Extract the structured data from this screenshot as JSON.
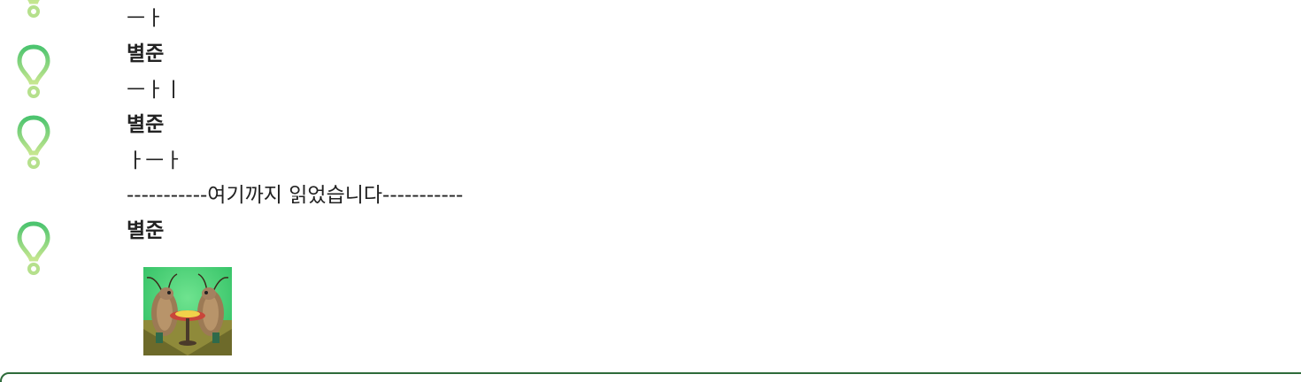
{
  "messages": [
    {
      "type": "text",
      "text": "ㅡㅏ"
    },
    {
      "type": "text",
      "sender": "별준",
      "avatar_icon": "balloon-pin-icon",
      "text": "ㅡㅏㅣ"
    },
    {
      "type": "text",
      "sender": "별준",
      "avatar_icon": "balloon-pin-icon",
      "text": "ㅏㅡㅏ"
    },
    {
      "type": "read-marker",
      "text": "-----------여기까지 읽었습니다-----------"
    },
    {
      "type": "sticker",
      "sender": "별준",
      "avatar_icon": "balloon-pin-icon",
      "sticker_icon": "cockroach-couple-sticker"
    }
  ],
  "colors": {
    "accent_green": "#5fc77a",
    "light_green": "#b5e08c",
    "composer_border": "#2e6b3a"
  }
}
